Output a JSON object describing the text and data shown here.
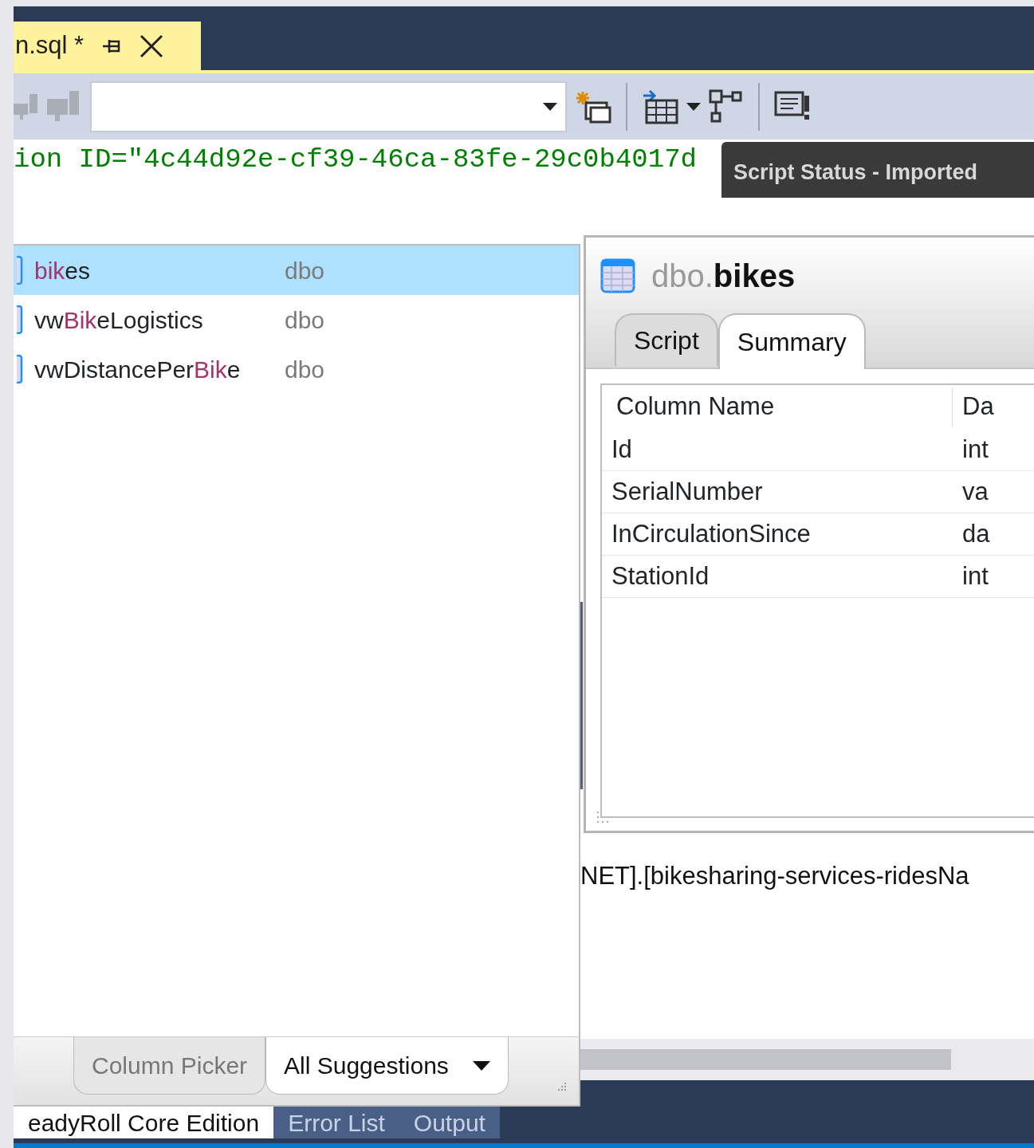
{
  "document_tab": {
    "title": "n.sql *",
    "selected": true
  },
  "editor": {
    "code_line": "ion ID=\"4c44d92e-cf39-46ca-83fe-29c0b4017d",
    "lower_line": "NET].[bikesharing-services-ridesNa"
  },
  "tooltip": "Script Status - Imported",
  "suggestions": {
    "items": [
      {
        "parts": [
          {
            "text": "bik",
            "match": true
          },
          {
            "text": "es",
            "match": false
          }
        ],
        "schema": "dbo",
        "selected": true
      },
      {
        "parts": [
          {
            "text": "vw",
            "match": false
          },
          {
            "text": "Bik",
            "match": true
          },
          {
            "text": "eLogistics",
            "match": false
          }
        ],
        "schema": "dbo",
        "selected": false
      },
      {
        "parts": [
          {
            "text": "vwDistancePer",
            "match": false
          },
          {
            "text": "Bik",
            "match": true
          },
          {
            "text": "e",
            "match": false
          }
        ],
        "schema": "dbo",
        "selected": false
      }
    ],
    "tabs": [
      {
        "label": "Column Picker",
        "selected": false,
        "dropdown": false
      },
      {
        "label": "All Suggestions",
        "selected": true,
        "dropdown": true
      }
    ]
  },
  "detail": {
    "schema": "dbo.",
    "name": "bikes",
    "tabs": [
      {
        "label": "Script",
        "selected": false
      },
      {
        "label": "Summary",
        "selected": true
      }
    ],
    "table": {
      "columns": [
        "Column Name",
        "Da"
      ],
      "rows": [
        [
          "Id",
          "int"
        ],
        [
          "SerialNumber",
          "va"
        ],
        [
          "InCirculationSince",
          "da"
        ],
        [
          "StationId",
          "int"
        ]
      ]
    }
  },
  "bottom_tabs": [
    {
      "label": "eadyRoll Core Edition",
      "selected": true
    },
    {
      "label": "Error List",
      "selected": false
    },
    {
      "label": "Output",
      "selected": false
    }
  ]
}
